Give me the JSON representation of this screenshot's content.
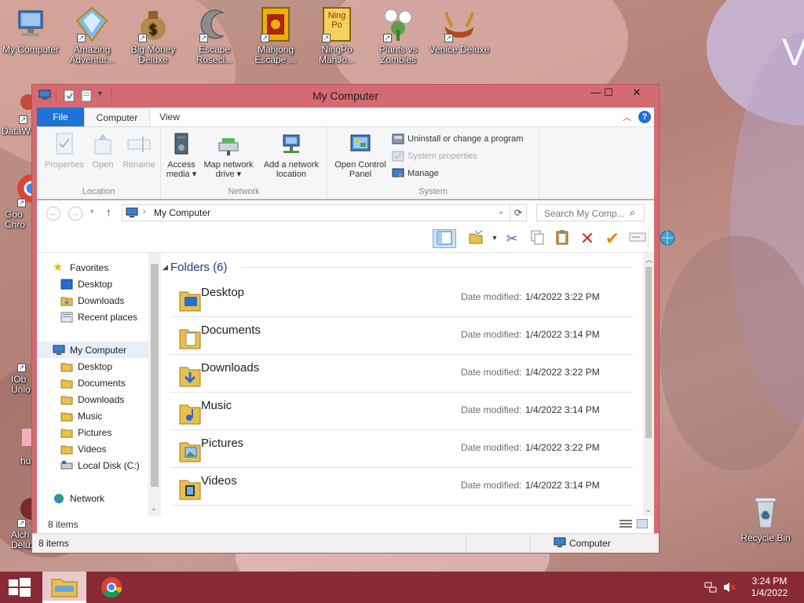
{
  "desktop": {
    "icons": [
      {
        "label": "My Computer",
        "icon": "my-computer-icon"
      },
      {
        "label": "Amazing Adventur...",
        "icon": "amazing-adventures-icon"
      },
      {
        "label": "Big Money Deluxe",
        "icon": "big-money-icon"
      },
      {
        "label": "Escape Rosecl...",
        "icon": "escape-rosecliff-icon"
      },
      {
        "label": "Mahjong Escape ...",
        "icon": "mahjong-icon"
      },
      {
        "label": "NingPo MahJo...",
        "icon": "ningpo-icon"
      },
      {
        "label": "Plants vs Zombies",
        "icon": "plants-vs-zombies-icon"
      },
      {
        "label": "Venice Deluxe",
        "icon": "venice-deluxe-icon"
      },
      {
        "label": "DataW...",
        "icon": "datawiz-icon"
      },
      {
        "label": "Goo Chro",
        "icon": "chrome-icon"
      },
      {
        "label": "IOb Unlo",
        "icon": "iobit-icon"
      },
      {
        "label": "hu",
        "icon": "hu-icon"
      },
      {
        "label": "Alch Delux",
        "icon": "alchemy-icon"
      },
      {
        "label": "Recycle Bin",
        "icon": "recycle-bin-icon"
      }
    ],
    "ningpo_logo_text": "Ning Po",
    "wallpaper_letter": "V"
  },
  "window": {
    "title": "My Computer",
    "controls": {
      "minimize": "—",
      "maximize": "☐",
      "close": "✕"
    },
    "tabs": [
      "File",
      "Computer",
      "View"
    ],
    "ribbon": {
      "location": {
        "name": "Location",
        "buttons": [
          "Properties",
          "Open",
          "Rename"
        ]
      },
      "network": {
        "name": "Network",
        "buttons": [
          {
            "line1": "Access",
            "line2": "media ▾"
          },
          {
            "line1": "Map network",
            "line2": "drive ▾"
          },
          {
            "line1": "Add a network",
            "line2": "location"
          }
        ]
      },
      "system": {
        "name": "System",
        "open_cp": {
          "line1": "Open Control",
          "line2": "Panel"
        },
        "small": [
          "Uninstall or change a program",
          "System properties",
          "Manage"
        ]
      }
    },
    "address": {
      "path": "My Computer",
      "search_placeholder": "Search My Comp..."
    },
    "nav": {
      "favorites": "Favorites",
      "fav_items": [
        "Desktop",
        "Downloads",
        "Recent places"
      ],
      "computer": "My Computer",
      "comp_items": [
        "Desktop",
        "Documents",
        "Downloads",
        "Music",
        "Pictures",
        "Videos",
        "Local Disk (C:)"
      ],
      "network": "Network"
    },
    "group_header": "Folders (6)",
    "files": [
      {
        "name": "Desktop",
        "label": "Date modified:",
        "date": "1/4/2022 3:22 PM"
      },
      {
        "name": "Documents",
        "label": "Date modified:",
        "date": "1/4/2022 3:14 PM"
      },
      {
        "name": "Downloads",
        "label": "Date modified:",
        "date": "1/4/2022 3:22 PM"
      },
      {
        "name": "Music",
        "label": "Date modified:",
        "date": "1/4/2022 3:14 PM"
      },
      {
        "name": "Pictures",
        "label": "Date modified:",
        "date": "1/4/2022 3:22 PM"
      },
      {
        "name": "Videos",
        "label": "Date modified:",
        "date": "1/4/2022 3:14 PM"
      }
    ],
    "inner_status": "8 items",
    "status": {
      "count": "8 items",
      "location": "Computer"
    }
  },
  "taskbar": {
    "time": "3:24 PM",
    "date": "1/4/2022"
  },
  "colors": {
    "window_frame": "#d46a72",
    "taskbar": "#872a35",
    "file_tab": "#1b74d6",
    "group_header": "#1e3a8a"
  }
}
